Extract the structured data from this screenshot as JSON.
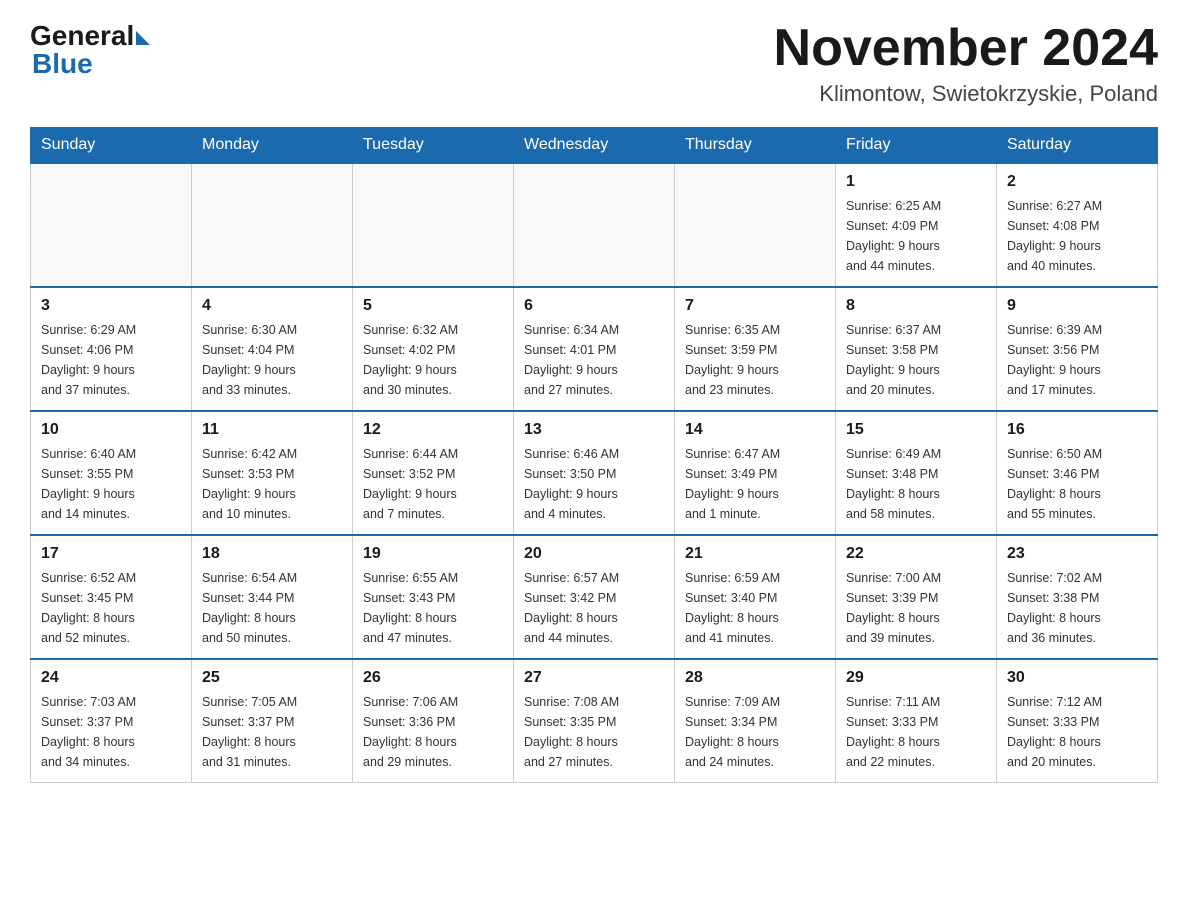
{
  "header": {
    "logo_general": "General",
    "logo_blue": "Blue",
    "title": "November 2024",
    "subtitle": "Klimontow, Swietokrzyskie, Poland"
  },
  "calendar": {
    "days_of_week": [
      "Sunday",
      "Monday",
      "Tuesday",
      "Wednesday",
      "Thursday",
      "Friday",
      "Saturday"
    ],
    "weeks": [
      [
        {
          "day": "",
          "info": ""
        },
        {
          "day": "",
          "info": ""
        },
        {
          "day": "",
          "info": ""
        },
        {
          "day": "",
          "info": ""
        },
        {
          "day": "",
          "info": ""
        },
        {
          "day": "1",
          "info": "Sunrise: 6:25 AM\nSunset: 4:09 PM\nDaylight: 9 hours\nand 44 minutes."
        },
        {
          "day": "2",
          "info": "Sunrise: 6:27 AM\nSunset: 4:08 PM\nDaylight: 9 hours\nand 40 minutes."
        }
      ],
      [
        {
          "day": "3",
          "info": "Sunrise: 6:29 AM\nSunset: 4:06 PM\nDaylight: 9 hours\nand 37 minutes."
        },
        {
          "day": "4",
          "info": "Sunrise: 6:30 AM\nSunset: 4:04 PM\nDaylight: 9 hours\nand 33 minutes."
        },
        {
          "day": "5",
          "info": "Sunrise: 6:32 AM\nSunset: 4:02 PM\nDaylight: 9 hours\nand 30 minutes."
        },
        {
          "day": "6",
          "info": "Sunrise: 6:34 AM\nSunset: 4:01 PM\nDaylight: 9 hours\nand 27 minutes."
        },
        {
          "day": "7",
          "info": "Sunrise: 6:35 AM\nSunset: 3:59 PM\nDaylight: 9 hours\nand 23 minutes."
        },
        {
          "day": "8",
          "info": "Sunrise: 6:37 AM\nSunset: 3:58 PM\nDaylight: 9 hours\nand 20 minutes."
        },
        {
          "day": "9",
          "info": "Sunrise: 6:39 AM\nSunset: 3:56 PM\nDaylight: 9 hours\nand 17 minutes."
        }
      ],
      [
        {
          "day": "10",
          "info": "Sunrise: 6:40 AM\nSunset: 3:55 PM\nDaylight: 9 hours\nand 14 minutes."
        },
        {
          "day": "11",
          "info": "Sunrise: 6:42 AM\nSunset: 3:53 PM\nDaylight: 9 hours\nand 10 minutes."
        },
        {
          "day": "12",
          "info": "Sunrise: 6:44 AM\nSunset: 3:52 PM\nDaylight: 9 hours\nand 7 minutes."
        },
        {
          "day": "13",
          "info": "Sunrise: 6:46 AM\nSunset: 3:50 PM\nDaylight: 9 hours\nand 4 minutes."
        },
        {
          "day": "14",
          "info": "Sunrise: 6:47 AM\nSunset: 3:49 PM\nDaylight: 9 hours\nand 1 minute."
        },
        {
          "day": "15",
          "info": "Sunrise: 6:49 AM\nSunset: 3:48 PM\nDaylight: 8 hours\nand 58 minutes."
        },
        {
          "day": "16",
          "info": "Sunrise: 6:50 AM\nSunset: 3:46 PM\nDaylight: 8 hours\nand 55 minutes."
        }
      ],
      [
        {
          "day": "17",
          "info": "Sunrise: 6:52 AM\nSunset: 3:45 PM\nDaylight: 8 hours\nand 52 minutes."
        },
        {
          "day": "18",
          "info": "Sunrise: 6:54 AM\nSunset: 3:44 PM\nDaylight: 8 hours\nand 50 minutes."
        },
        {
          "day": "19",
          "info": "Sunrise: 6:55 AM\nSunset: 3:43 PM\nDaylight: 8 hours\nand 47 minutes."
        },
        {
          "day": "20",
          "info": "Sunrise: 6:57 AM\nSunset: 3:42 PM\nDaylight: 8 hours\nand 44 minutes."
        },
        {
          "day": "21",
          "info": "Sunrise: 6:59 AM\nSunset: 3:40 PM\nDaylight: 8 hours\nand 41 minutes."
        },
        {
          "day": "22",
          "info": "Sunrise: 7:00 AM\nSunset: 3:39 PM\nDaylight: 8 hours\nand 39 minutes."
        },
        {
          "day": "23",
          "info": "Sunrise: 7:02 AM\nSunset: 3:38 PM\nDaylight: 8 hours\nand 36 minutes."
        }
      ],
      [
        {
          "day": "24",
          "info": "Sunrise: 7:03 AM\nSunset: 3:37 PM\nDaylight: 8 hours\nand 34 minutes."
        },
        {
          "day": "25",
          "info": "Sunrise: 7:05 AM\nSunset: 3:37 PM\nDaylight: 8 hours\nand 31 minutes."
        },
        {
          "day": "26",
          "info": "Sunrise: 7:06 AM\nSunset: 3:36 PM\nDaylight: 8 hours\nand 29 minutes."
        },
        {
          "day": "27",
          "info": "Sunrise: 7:08 AM\nSunset: 3:35 PM\nDaylight: 8 hours\nand 27 minutes."
        },
        {
          "day": "28",
          "info": "Sunrise: 7:09 AM\nSunset: 3:34 PM\nDaylight: 8 hours\nand 24 minutes."
        },
        {
          "day": "29",
          "info": "Sunrise: 7:11 AM\nSunset: 3:33 PM\nDaylight: 8 hours\nand 22 minutes."
        },
        {
          "day": "30",
          "info": "Sunrise: 7:12 AM\nSunset: 3:33 PM\nDaylight: 8 hours\nand 20 minutes."
        }
      ]
    ]
  }
}
